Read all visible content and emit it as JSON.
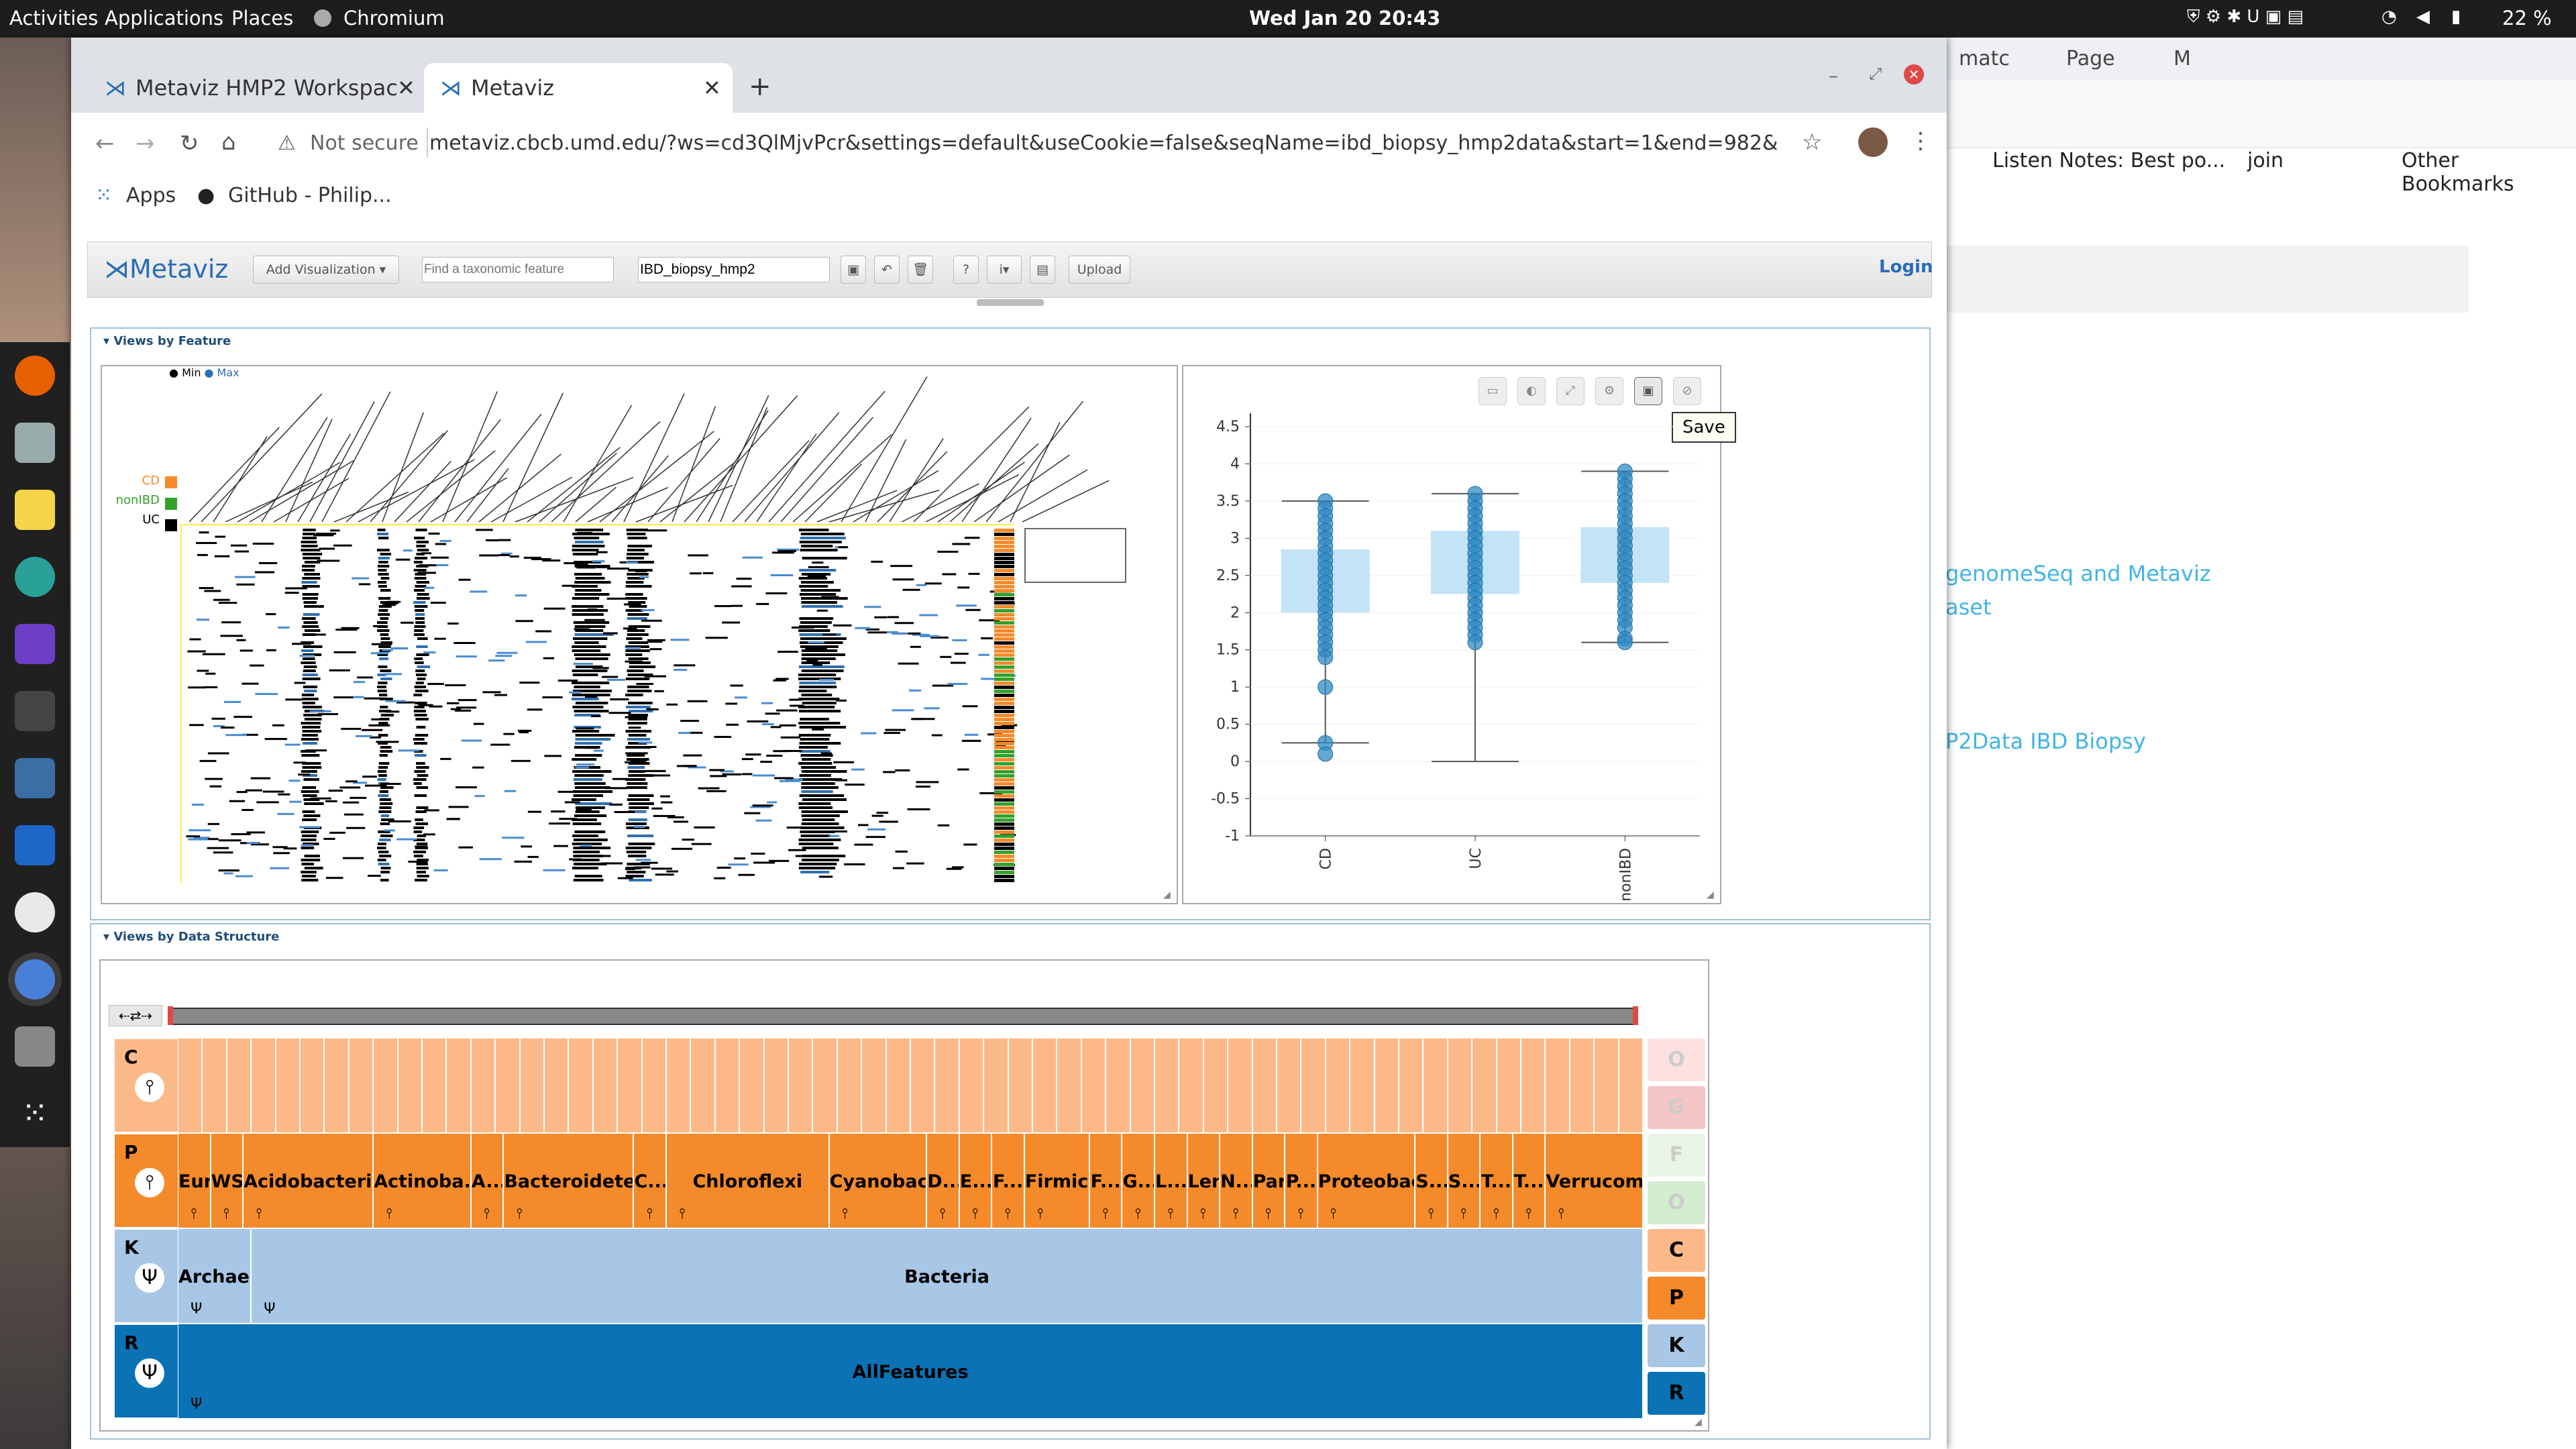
{
  "topbar": {
    "activities": "Activities",
    "applications": "Applications",
    "places": "Places",
    "app": "Chromium",
    "clock": "Wed Jan 20  20:43",
    "battery": "22 %"
  },
  "firefox": {
    "tabs": [
      "matc",
      "Page",
      "M"
    ],
    "bookmarks": [
      "Listen Notes: Best po...",
      "join",
      "Other Bookmarks"
    ],
    "links": [
      "genomeSeq and Metaviz",
      "aset",
      "P2Data IBD Biopsy"
    ]
  },
  "chrome": {
    "tabs": [
      {
        "title": "Metaviz HMP2 Workspac"
      },
      {
        "title": "Metaviz"
      }
    ],
    "security": "Not secure",
    "url": "metaviz.cbcb.umd.edu/?ws=cd3QlMjvPcr&settings=default&useCookie=false&seqName=ibd_biopsy_hmp2data&start=1&end=982&",
    "bookmarks": [
      "Apps",
      "GitHub - Philip..."
    ]
  },
  "metaviz": {
    "logo": "Metaviz",
    "add_visualization": "Add Visualization",
    "search_placeholder": "Find a taxonomic feature",
    "dataset": "IBD_biopsy_hmp2",
    "upload": "Upload",
    "login": "Login",
    "views_by_feature": "Views by Feature",
    "views_by_data_structure": "Views by Data Structure",
    "save_tooltip": "Save",
    "heatmap_legend": {
      "min": "Min",
      "max": "Max",
      "groups": [
        {
          "label": "CD",
          "color": "#f58a2a"
        },
        {
          "label": "nonIBD",
          "color": "#33a02c"
        },
        {
          "label": "UC",
          "color": "#000000"
        }
      ]
    }
  },
  "chart_data": {
    "type": "scatter",
    "categories": [
      "CD",
      "UC",
      "nonIBD"
    ],
    "ylim": [
      -1,
      4.5
    ],
    "yticks": [
      "4.5",
      "4",
      "3.5",
      "3",
      "2.5",
      "2",
      "1.5",
      "1",
      "0.5",
      "0",
      "-0.5",
      "-1"
    ],
    "boxes": [
      {
        "category": "CD",
        "q1": 2.0,
        "q3": 2.85,
        "whisker_low": 0.25,
        "whisker_high": 3.5
      },
      {
        "category": "UC",
        "q1": 2.25,
        "q3": 3.1,
        "whisker_low": 0.0,
        "whisker_high": 3.6
      },
      {
        "category": "nonIBD",
        "q1": 2.4,
        "q3": 3.15,
        "whisker_low": 1.6,
        "whisker_high": 3.9
      }
    ],
    "points": [
      {
        "category": "CD",
        "values": [
          3.5,
          3.4,
          3.3,
          3.2,
          3.1,
          3.0,
          2.9,
          2.8,
          2.7,
          2.6,
          2.5,
          2.4,
          2.3,
          2.2,
          2.1,
          2.0,
          1.9,
          1.8,
          1.7,
          1.6,
          1.5,
          1.4,
          1.0,
          0.25,
          0.1
        ]
      },
      {
        "category": "UC",
        "values": [
          3.6,
          3.5,
          3.4,
          3.3,
          3.2,
          3.1,
          3.0,
          2.9,
          2.8,
          2.7,
          2.6,
          2.5,
          2.4,
          2.3,
          2.2,
          2.1,
          2.0,
          1.9,
          1.8,
          1.7,
          1.6
        ]
      },
      {
        "category": "nonIBD",
        "values": [
          3.9,
          3.8,
          3.7,
          3.6,
          3.5,
          3.4,
          3.3,
          3.2,
          3.1,
          3.0,
          2.9,
          2.8,
          2.7,
          2.6,
          2.5,
          2.4,
          2.3,
          2.2,
          2.1,
          2.0,
          1.9,
          1.8,
          1.65,
          1.6
        ]
      }
    ]
  },
  "icicle": {
    "levels": [
      {
        "letter": "C",
        "nodes": []
      },
      {
        "letter": "P",
        "nodes": [
          {
            "label": "Eur",
            "w": 1
          },
          {
            "label": "WSA",
            "w": 1
          },
          {
            "label": "Acidobacteria",
            "w": 4
          },
          {
            "label": "Actinoba...",
            "w": 3
          },
          {
            "label": "A...",
            "w": 1
          },
          {
            "label": "Bacteroidetes",
            "w": 4
          },
          {
            "label": "C...",
            "w": 1
          },
          {
            "label": "Chloroflexi",
            "w": 5
          },
          {
            "label": "Cyanobac...",
            "w": 3
          },
          {
            "label": "D...",
            "w": 1
          },
          {
            "label": "E...",
            "w": 1
          },
          {
            "label": "F...",
            "w": 1
          },
          {
            "label": "Firmic...",
            "w": 2
          },
          {
            "label": "F...",
            "w": 1
          },
          {
            "label": "G...",
            "w": 1
          },
          {
            "label": "L...",
            "w": 1
          },
          {
            "label": "Len...",
            "w": 1
          },
          {
            "label": "N...",
            "w": 1
          },
          {
            "label": "Par...",
            "w": 1
          },
          {
            "label": "P...",
            "w": 1
          },
          {
            "label": "Proteobact...",
            "w": 3
          },
          {
            "label": "S...",
            "w": 1
          },
          {
            "label": "S...",
            "w": 1
          },
          {
            "label": "T...",
            "w": 1
          },
          {
            "label": "T...",
            "w": 1
          },
          {
            "label": "Verrucomic...",
            "w": 3
          }
        ]
      },
      {
        "letter": "K",
        "nodes": [
          {
            "label": "Archaea",
            "w": 2
          },
          {
            "label": "Bacteria",
            "w": 38
          }
        ]
      },
      {
        "letter": "R",
        "nodes": [
          {
            "label": "AllFeatures",
            "w": 40
          }
        ]
      }
    ],
    "level_buttons": [
      "O",
      "G",
      "F",
      "O",
      "C",
      "P",
      "K",
      "R"
    ]
  }
}
